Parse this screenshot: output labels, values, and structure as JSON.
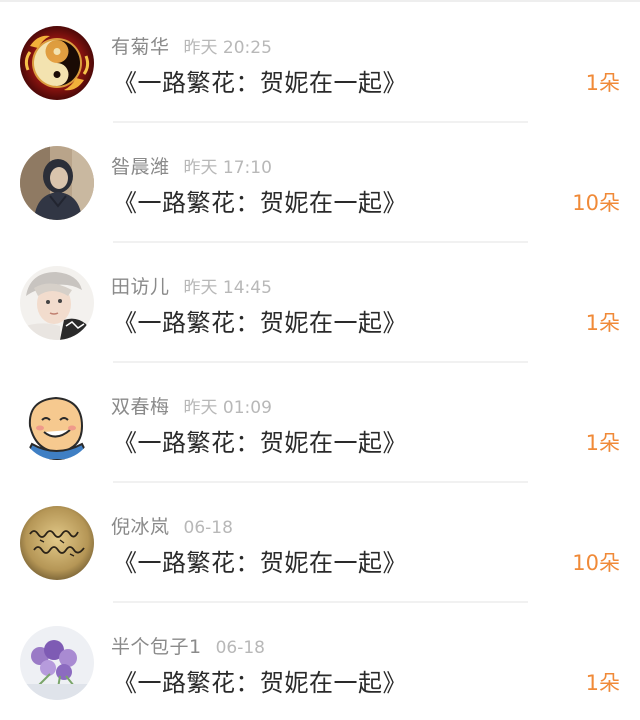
{
  "records": [
    {
      "name": "有菊华",
      "time": "昨天 20:25",
      "message": "《一路繁花：贺妮在一起》",
      "count": "1朵",
      "avatar": "yin-yang-dragon-avatar"
    },
    {
      "name": "昝晨潍",
      "time": "昨天 17:10",
      "message": "《一路繁花：贺妮在一起》",
      "count": "10朵",
      "avatar": "hooded-person-avatar"
    },
    {
      "name": "田访儿",
      "time": "昨天 14:45",
      "message": "《一路繁花：贺妮在一起》",
      "count": "1朵",
      "avatar": "boy-face-avatar"
    },
    {
      "name": "双春梅",
      "time": "昨天 01:09",
      "message": "《一路繁花：贺妮在一起》",
      "count": "1朵",
      "avatar": "cartoon-bald-man-avatar"
    },
    {
      "name": "倪冰岚",
      "time": "06-18",
      "message": "《一路繁花：贺妮在一起》",
      "count": "10朵",
      "avatar": "handwriting-note-avatar"
    },
    {
      "name": "半个包子1",
      "time": "06-18",
      "message": "《一路繁花：贺妮在一起》",
      "count": "1朵",
      "avatar": "purple-flowers-avatar"
    }
  ]
}
